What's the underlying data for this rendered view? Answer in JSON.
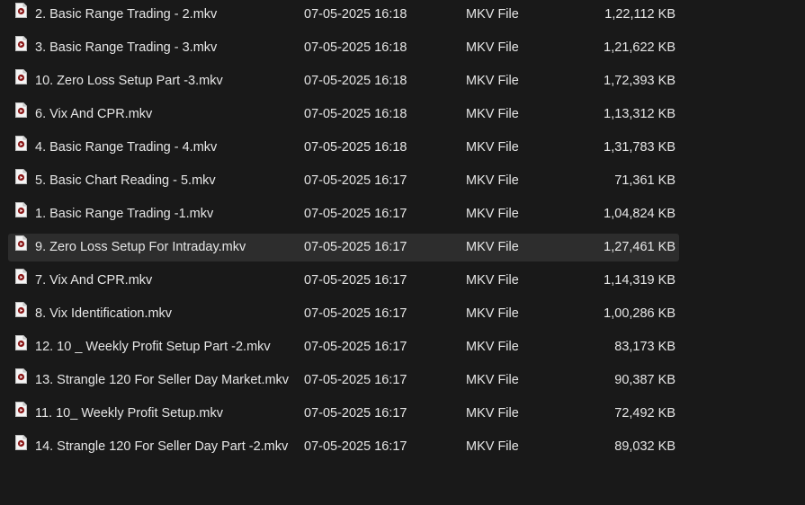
{
  "files": [
    {
      "name": "2. Basic Range Trading - 2.mkv",
      "date": "07-05-2025 16:18",
      "type": "MKV File",
      "size": "1,22,112 KB",
      "selected": false
    },
    {
      "name": "3. Basic Range Trading - 3.mkv",
      "date": "07-05-2025 16:18",
      "type": "MKV File",
      "size": "1,21,622 KB",
      "selected": false
    },
    {
      "name": "10. Zero Loss Setup Part -3.mkv",
      "date": "07-05-2025 16:18",
      "type": "MKV File",
      "size": "1,72,393 KB",
      "selected": false
    },
    {
      "name": "6. Vix And CPR.mkv",
      "date": "07-05-2025 16:18",
      "type": "MKV File",
      "size": "1,13,312 KB",
      "selected": false
    },
    {
      "name": "4. Basic Range Trading - 4.mkv",
      "date": "07-05-2025 16:18",
      "type": "MKV File",
      "size": "1,31,783 KB",
      "selected": false
    },
    {
      "name": "5. Basic Chart Reading - 5.mkv",
      "date": "07-05-2025 16:17",
      "type": "MKV File",
      "size": "71,361 KB",
      "selected": false
    },
    {
      "name": "1. Basic Range Trading -1.mkv",
      "date": "07-05-2025 16:17",
      "type": "MKV File",
      "size": "1,04,824 KB",
      "selected": false
    },
    {
      "name": "9. Zero Loss Setup For Intraday.mkv",
      "date": "07-05-2025 16:17",
      "type": "MKV File",
      "size": "1,27,461 KB",
      "selected": true
    },
    {
      "name": "7. Vix And CPR.mkv",
      "date": "07-05-2025 16:17",
      "type": "MKV File",
      "size": "1,14,319 KB",
      "selected": false
    },
    {
      "name": "8. Vix Identification.mkv",
      "date": "07-05-2025 16:17",
      "type": "MKV File",
      "size": "1,00,286 KB",
      "selected": false
    },
    {
      "name": "12. 10 _ Weekly Profit Setup Part -2.mkv",
      "date": "07-05-2025 16:17",
      "type": "MKV File",
      "size": "83,173 KB",
      "selected": false
    },
    {
      "name": "13. Strangle 120 For Seller Day Market.mkv",
      "date": "07-05-2025 16:17",
      "type": "MKV File",
      "size": "90,387 KB",
      "selected": false
    },
    {
      "name": "11. 10_ Weekly Profit Setup.mkv",
      "date": "07-05-2025 16:17",
      "type": "MKV File",
      "size": "72,492 KB",
      "selected": false
    },
    {
      "name": "14. Strangle 120 For Seller Day Part -2.mkv",
      "date": "07-05-2025 16:17",
      "type": "MKV File",
      "size": "89,032 KB",
      "selected": false
    }
  ],
  "icon_name": "video-file-icon",
  "colors": {
    "background": "#191919",
    "selected_row": "#2d2d2d",
    "text": "#e6e6e6",
    "icon_accent": "#8b1a1a"
  }
}
